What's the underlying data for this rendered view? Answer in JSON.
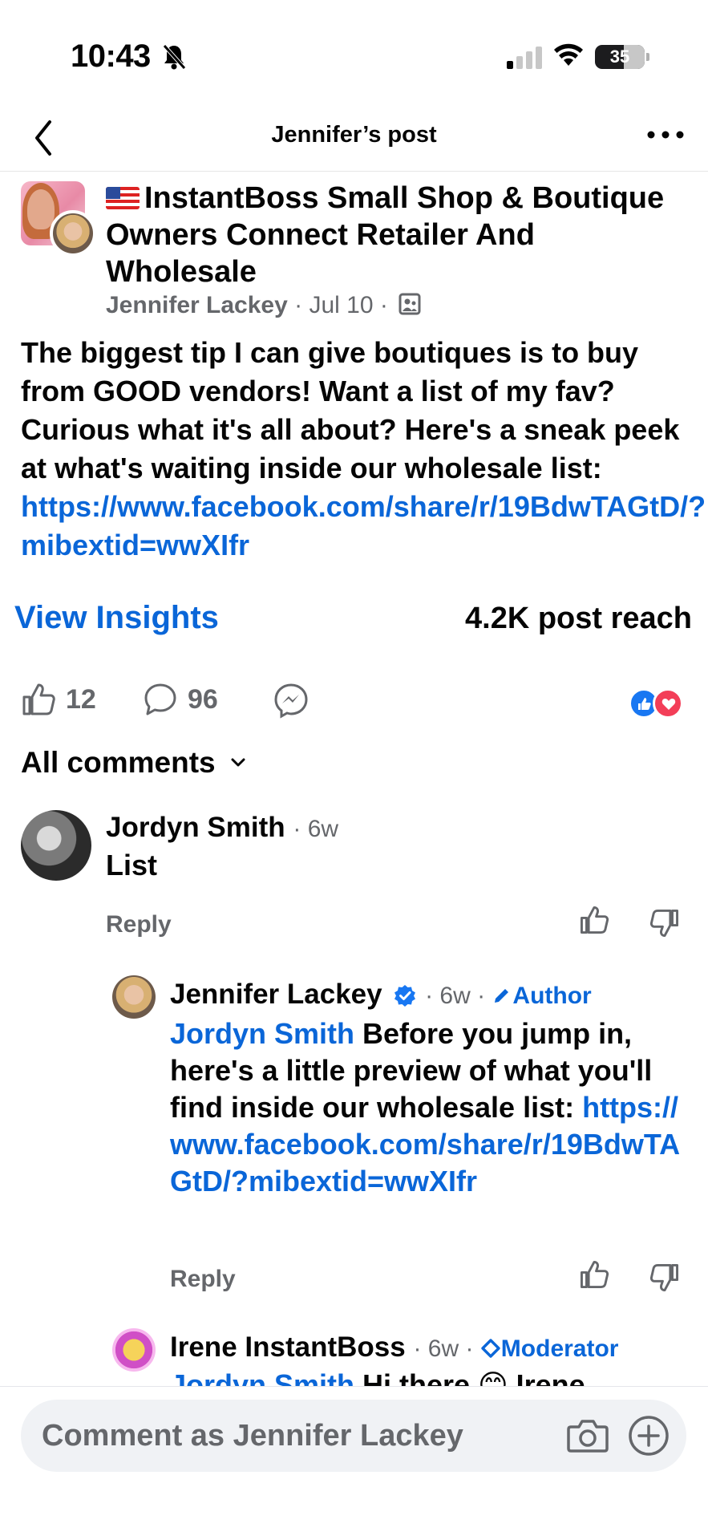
{
  "status_bar": {
    "time": "10:43",
    "battery": "35"
  },
  "header": {
    "title": "Jennifer’s post"
  },
  "post": {
    "group_name": "InstantBoss Small Shop & Boutique Owners Connect Retailer And Wholesale",
    "author": "Jennifer Lackey",
    "date": "Jul 10",
    "body_text": "The biggest tip I can give boutiques is to buy from GOOD vendors! Want a list of my fav? Curious what it's all about? Here's a sneak peek at what's waiting inside our wholesale list: ",
    "body_link": "https://www.facebook.com/share/r/19BdwTAGtD/?mibextid=wwXIfr",
    "view_insights": "View Insights",
    "post_reach": "4.2K post reach",
    "likes": "12",
    "comments": "96"
  },
  "comments_section": {
    "filter_label": "All comments"
  },
  "comments": [
    {
      "name": "Jordyn Smith",
      "time": "6w",
      "text": "List",
      "reply": "Reply"
    },
    {
      "name": "Jennifer Lackey",
      "time": "6w",
      "badge": "Author",
      "mention": "Jordyn Smith",
      "text": " Before you jump in, here's a little preview of what you'll find inside our wholesale list: ",
      "link": "https://www.facebook.com/share/r/19BdwTAGtD/?mibextid=wwXIfr",
      "reply": "Reply"
    },
    {
      "name": "Irene InstantBoss",
      "time": "6w",
      "badge": "Moderator",
      "mention": "Jordyn Smith",
      "text": " Hi there 😊 Irene"
    }
  ],
  "composer": {
    "placeholder": "Comment as Jennifer Lackey"
  },
  "colors": {
    "link": "#0a66d8",
    "secondary_text": "#65676b",
    "like_blue": "#1877f2",
    "love_red": "#f33e58"
  }
}
